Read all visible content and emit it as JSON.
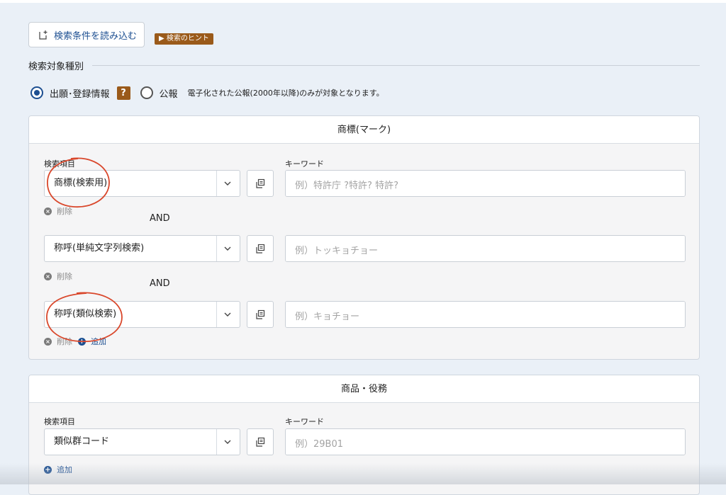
{
  "toolbar": {
    "load_label": "検索条件を読み込む",
    "hint_label": "▶ 検索のヒント"
  },
  "target": {
    "section_label": "検索対象種別",
    "option1": "出願･登録情報",
    "help_badge": "?",
    "option2": "公報",
    "note": "電子化された公報(2000年以降)のみが対象となります。",
    "selected": "出願･登録情報"
  },
  "trademark_panel": {
    "title": "商標(マーク)",
    "item_label": "検索項目",
    "keyword_label": "キーワード",
    "and_label": "AND",
    "delete_label": "削除",
    "add_label": "追加",
    "rows": [
      {
        "field": "商標(検索用)",
        "placeholder": "例）特許庁 ?特許? 特許?"
      },
      {
        "field": "称呼(単純文字列検索)",
        "placeholder": "例）トッキョチョー"
      },
      {
        "field": "称呼(類似検索)",
        "placeholder": "例）キョチョー"
      }
    ]
  },
  "goods_panel": {
    "title": "商品・役務",
    "item_label": "検索項目",
    "keyword_label": "キーワード",
    "add_label": "追加",
    "rows": [
      {
        "field": "類似群コード",
        "placeholder": "例）29B01"
      }
    ]
  },
  "colors": {
    "accent": "#1d4f91",
    "badge": "#9a5a1a",
    "annotation": "#d9472b"
  }
}
